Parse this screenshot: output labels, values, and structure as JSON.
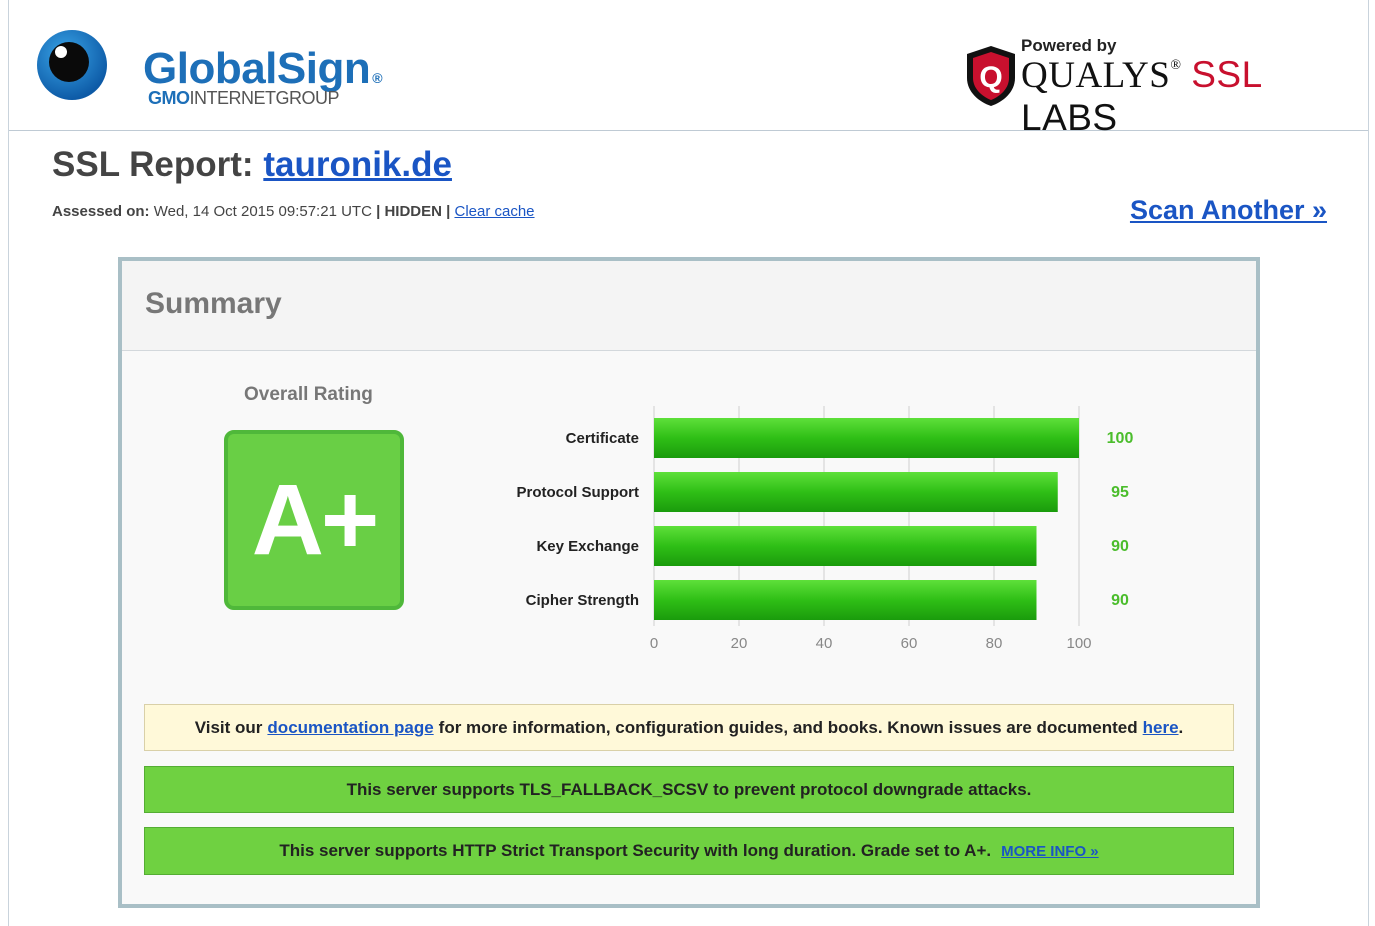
{
  "header": {
    "globalsign": {
      "name": "GlobalSign",
      "registered": "®",
      "sub_bold": "GMO",
      "sub_rest": "INTERNETGROUP"
    },
    "qualys": {
      "powered_by": "Powered by",
      "brand": "QUALYS",
      "brand_mark": "®",
      "ssl": "SSL",
      "labs": "LABS"
    }
  },
  "report": {
    "title_prefix": "SSL Report:",
    "domain": "tauronik.de",
    "assessed_label": "Assessed on:",
    "assessed_value": "Wed, 14 Oct 2015 09:57:21 UTC",
    "hidden": "| HIDDEN |",
    "clear_cache": "Clear cache",
    "scan_another": "Scan Another »"
  },
  "summary": {
    "title": "Summary",
    "overall_label": "Overall Rating",
    "grade": "A+"
  },
  "colors": {
    "bar": "#2fbf16",
    "value_text": "#4bbd2c",
    "grade_bg": "#69cf45",
    "link": "#1a55c4"
  },
  "chart_data": {
    "type": "bar",
    "orientation": "horizontal",
    "categories": [
      "Certificate",
      "Protocol Support",
      "Key Exchange",
      "Cipher Strength"
    ],
    "values": [
      100,
      95,
      90,
      90
    ],
    "value_labels": [
      "100",
      "95",
      "90",
      "90"
    ],
    "xlim": [
      0,
      100
    ],
    "x_ticks": [
      0,
      20,
      40,
      60,
      80,
      100
    ],
    "grid": true
  },
  "messages": {
    "doc": {
      "pre": "Visit our",
      "link1": "documentation page",
      "mid": "for more information, configuration guides, and books. Known issues are documented",
      "link2": "here",
      "post": "."
    },
    "fallback": "This server supports TLS_FALLBACK_SCSV to prevent protocol downgrade attacks.",
    "hsts": "This server supports HTTP Strict Transport Security with long duration. Grade set to A+.",
    "more_info": "MORE INFO »"
  }
}
